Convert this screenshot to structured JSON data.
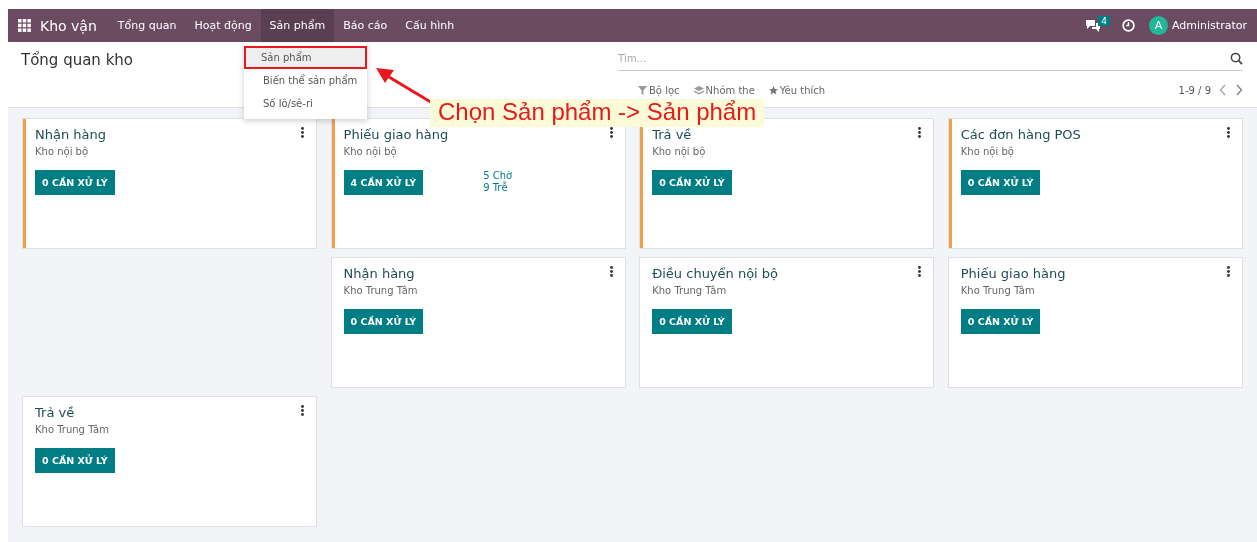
{
  "navbar": {
    "app_name": "Kho vận",
    "menu": [
      {
        "label": "Tổng quan",
        "selected": false
      },
      {
        "label": "Hoạt động",
        "selected": false
      },
      {
        "label": "Sản phẩm",
        "selected": true
      },
      {
        "label": "Báo cáo",
        "selected": false
      },
      {
        "label": "Cấu hình",
        "selected": false
      }
    ],
    "messages_badge": "4",
    "user_initial": "A",
    "user_name": "Administrator"
  },
  "dropdown": {
    "items": [
      {
        "label": "Sản phẩm",
        "selected": true
      },
      {
        "label": "Biến thể sản phẩm",
        "selected": false
      },
      {
        "label": "Số lô/sê-ri",
        "selected": false
      }
    ]
  },
  "control_panel": {
    "title": "Tổng quan kho",
    "search": {
      "placeholder": "Tìm..."
    },
    "filters": [
      "Bộ lọc",
      "Nhóm the",
      "Yêu thích"
    ],
    "pager": "1-9 / 9"
  },
  "annotation": "Chọn Sản phẩm -> Sản phẩm",
  "cards": [
    {
      "title": "Nhận hàng",
      "warehouse": "Kho nội bộ",
      "button": "0 CẦN XỬ LÝ",
      "color": "#f0a04b"
    },
    {
      "title": "Phiếu giao hàng",
      "warehouse": "Kho nội bộ",
      "button": "4 CẦN XỬ LÝ",
      "stats": [
        "5 Chờ",
        "9 Trễ"
      ],
      "color": "#f0a04b"
    },
    {
      "title": "Trả về",
      "warehouse": "Kho nội bộ",
      "button": "0 CẦN XỬ LÝ",
      "color": "#f0a04b"
    },
    {
      "title": "Các đơn hàng POS",
      "warehouse": "Kho nội bộ",
      "button": "0 CẦN XỬ LÝ",
      "color": "#f0a04b"
    },
    {
      "title": "Nhận hàng",
      "warehouse": "Kho Trung Tâm",
      "button": "0 CẦN XỬ LÝ"
    },
    {
      "title": "Điều chuyển nội bộ",
      "warehouse": "Kho Trung Tâm",
      "button": "0 CẦN XỬ LÝ"
    },
    {
      "title": "Phiếu giao hàng",
      "warehouse": "Kho Trung Tâm",
      "button": "0 CẦN XỬ LÝ"
    },
    {
      "title": "Trả về",
      "warehouse": "Kho Trung Tâm",
      "button": "0 CẦN XỬ LÝ"
    }
  ]
}
